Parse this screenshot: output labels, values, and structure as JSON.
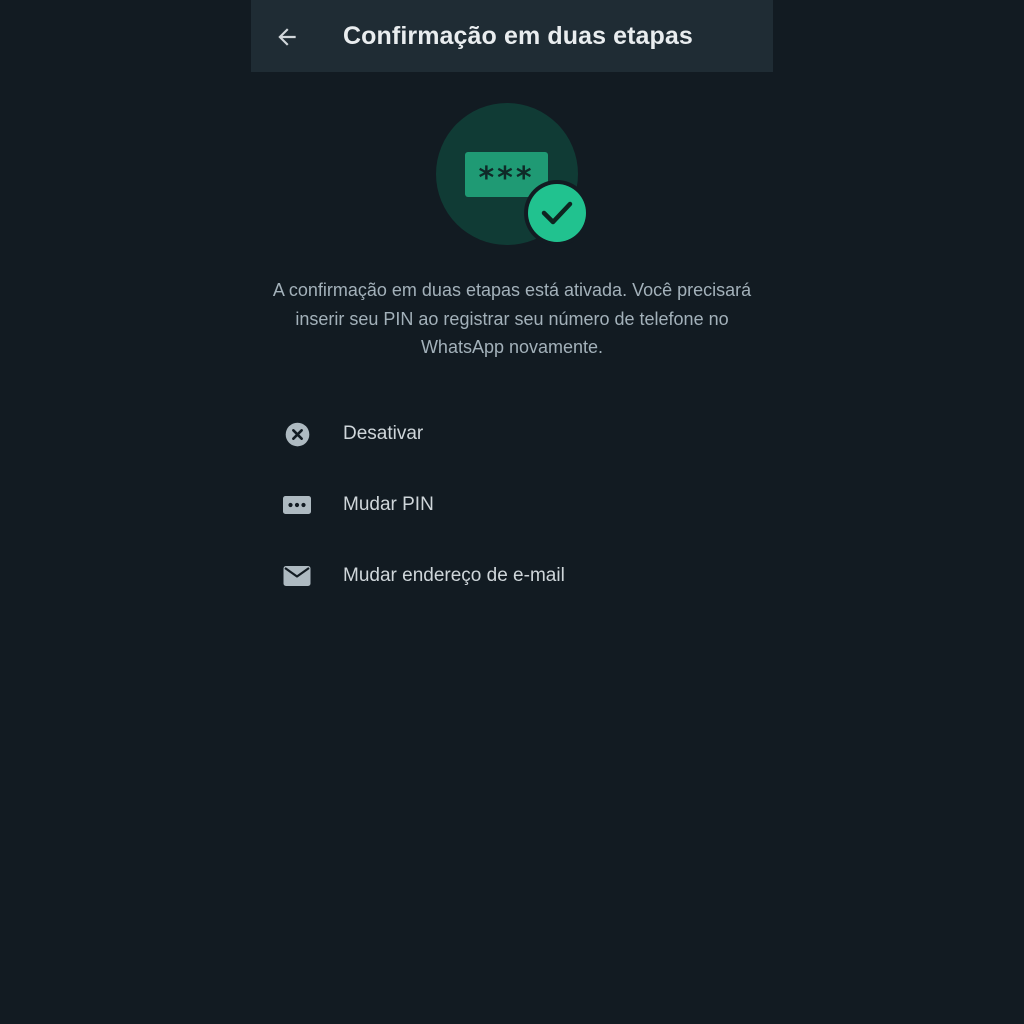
{
  "header": {
    "title": "Confirmação em duas etapas",
    "back_icon": "arrow-left-icon"
  },
  "hero": {
    "pin_mask": "***",
    "icons": [
      "password-card-icon",
      "check-badge-icon"
    ]
  },
  "description": "A confirmação em duas etapas está ativada. Você precisará inserir seu PIN ao registrar seu número de telefone no WhatsApp novamente.",
  "options": [
    {
      "label": "Desativar",
      "icon": "close-circle-icon"
    },
    {
      "label": "Mudar PIN",
      "icon": "pin-dots-icon"
    },
    {
      "label": "Mudar endereço de e-mail",
      "icon": "mail-icon"
    }
  ],
  "colors": {
    "background": "#121b22",
    "app_bar": "#1f2c34",
    "accent": "#00a884",
    "check_badge": "#21c28f",
    "text_primary": "#e9edef",
    "text_secondary": "#a3b1ba",
    "icon": "#aebac1"
  }
}
